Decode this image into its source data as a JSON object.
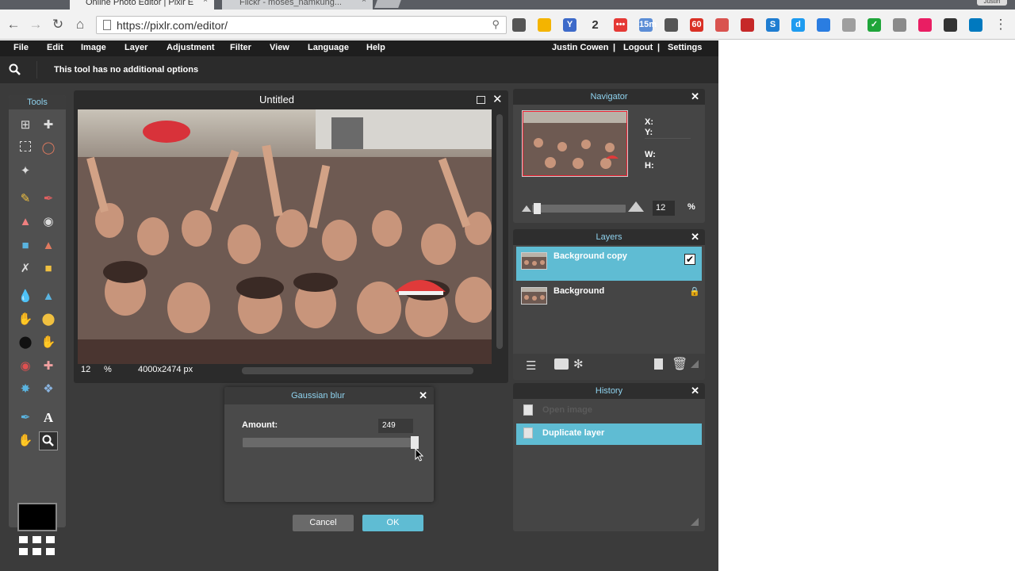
{
  "browser": {
    "tabs": [
      {
        "label": "Online Photo Editor | Pixlr E",
        "close": "×"
      },
      {
        "label": "Flickr - moses_namkung...",
        "close": "×"
      }
    ],
    "profile_label": "Justin",
    "url": "https://pixlr.com/editor/",
    "extensions": [
      {
        "name": "reader-icon",
        "label": "",
        "color": "#555555"
      },
      {
        "name": "drive-icon",
        "label": "",
        "color": "#f4b400"
      },
      {
        "name": "y-icon",
        "label": "Y",
        "color": "#3d6ac9"
      },
      {
        "name": "two-icon",
        "label": "2",
        "color": "#f2f2f2"
      },
      {
        "name": "dots-icon",
        "label": "•••",
        "color": "#e53935"
      },
      {
        "name": "timer-icon",
        "label": "15m",
        "color": "#5b8dd6"
      },
      {
        "name": "puzzle-icon",
        "label": "",
        "color": "#555555"
      },
      {
        "name": "gmail-icon",
        "label": "60",
        "color": "#d93025"
      },
      {
        "name": "red-square-icon",
        "label": "",
        "color": "#d9534f"
      },
      {
        "name": "lastpass-icon",
        "label": "",
        "color": "#c62828"
      },
      {
        "name": "s-icon",
        "label": "S",
        "color": "#1f7dd1"
      },
      {
        "name": "d-icon",
        "label": "d",
        "color": "#1d9bf0"
      },
      {
        "name": "pin-icon",
        "label": "",
        "color": "#2a7de1"
      },
      {
        "name": "cloud-icon",
        "label": "",
        "color": "#9e9e9e"
      },
      {
        "name": "check-icon",
        "label": "✓",
        "color": "#1fa53a"
      },
      {
        "name": "grey-square-icon",
        "label": "",
        "color": "#8a8a8a"
      },
      {
        "name": "camera-icon",
        "label": "",
        "color": "#e91e63"
      },
      {
        "name": "game-icon",
        "label": "",
        "color": "#333333"
      },
      {
        "name": "trello-icon",
        "label": "",
        "color": "#0079bf"
      }
    ]
  },
  "menubar": {
    "items": [
      "File",
      "Edit",
      "Image",
      "Layer",
      "Adjustment",
      "Filter",
      "View",
      "Language",
      "Help"
    ],
    "user": "Justin Cowen",
    "logout": "Logout",
    "settings": "Settings",
    "sep": "|"
  },
  "options": {
    "text": "This tool has no additional options"
  },
  "tools": {
    "title": "Tools"
  },
  "document": {
    "title": "Untitled",
    "zoom": "12",
    "zoom_unit": "%",
    "size": "4000x2474 px"
  },
  "navigator": {
    "title": "Navigator",
    "x_label": "X:",
    "y_label": "Y:",
    "w_label": "W:",
    "h_label": "H:",
    "zoom": "12",
    "zoom_unit": "%",
    "zoom_fraction": 0.02
  },
  "layers": {
    "title": "Layers",
    "items": [
      {
        "name": "Background copy",
        "active": true,
        "visible": true
      },
      {
        "name": "Background",
        "active": false,
        "locked": true
      }
    ]
  },
  "history": {
    "title": "History",
    "items": [
      {
        "name": "Open image",
        "active": false
      },
      {
        "name": "Duplicate layer",
        "active": true
      }
    ]
  },
  "dialog": {
    "title": "Gaussian blur",
    "amount_label": "Amount:",
    "amount_value": "249",
    "amount_fraction": 1.0,
    "cancel": "Cancel",
    "ok": "OK"
  },
  "colors": {
    "accent": "#5fbcd3",
    "panel_title": "#8fd3ef"
  }
}
